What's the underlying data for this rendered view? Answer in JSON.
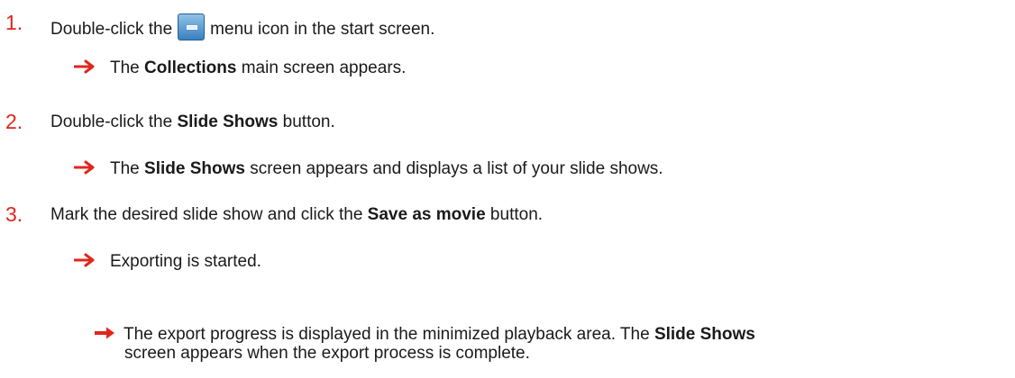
{
  "steps": [
    {
      "number": "1.",
      "text_before": "Double-click the",
      "icon": "collections-menu-icon",
      "text_after": "menu icon in the start screen.",
      "result": {
        "pre": "The ",
        "bold": "Collections",
        "post": " main screen appears."
      }
    },
    {
      "number": "2.",
      "text_before": "Double-click the ",
      "bold": "Slide Shows",
      "text_after": " button.",
      "result": {
        "pre": "The ",
        "bold": "Slide Shows",
        "post": " screen appears and displays a list of your slide shows."
      }
    },
    {
      "number": "3.",
      "text_before": "Mark the desired slide show and click the ",
      "bold": "Save as movie",
      "text_after": " button.",
      "result": {
        "text": "Exporting is started."
      },
      "subresult": {
        "pre": "The export progress is displayed in the minimized playback area. The ",
        "bold": "Slide Shows",
        "line2": "screen appears when the export process is complete."
      }
    }
  ],
  "colors": {
    "step_number": "#e0261b",
    "arrow": "#e0261b",
    "text": "#1a1a1a"
  }
}
